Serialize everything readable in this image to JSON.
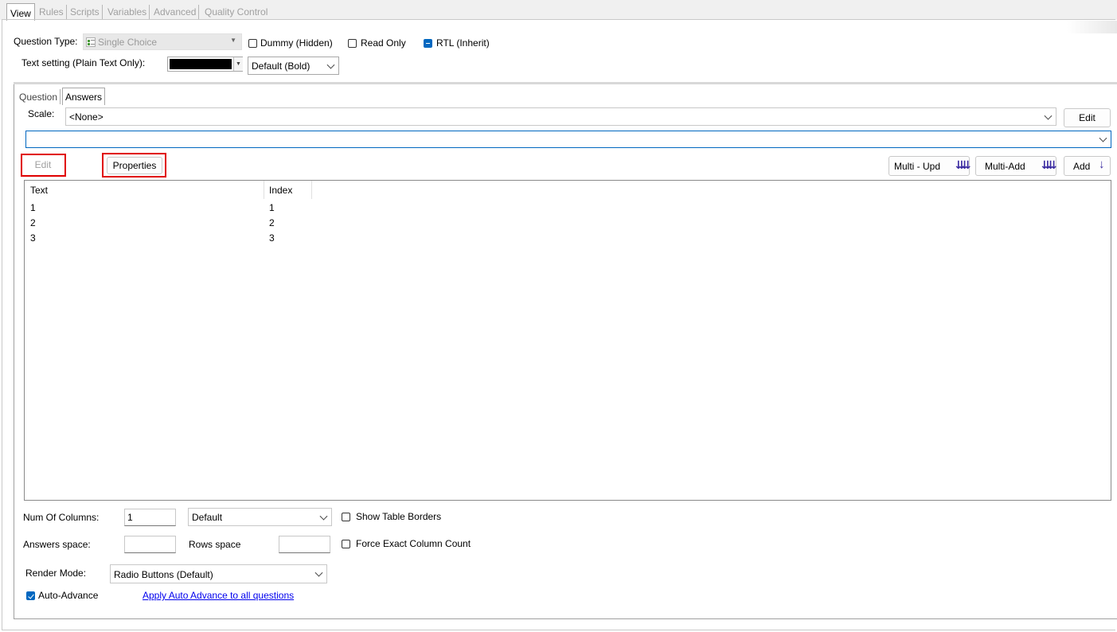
{
  "top_tabs": [
    "View",
    "Rules",
    "Scripts",
    "Variables",
    "Advanced",
    "Quality Control"
  ],
  "question_type": {
    "label": "Question Type:",
    "value": "Single Choice"
  },
  "checkboxes": {
    "dummy": "Dummy (Hidden)",
    "read_only": "Read Only",
    "rtl": "RTL (Inherit)"
  },
  "text_setting": {
    "label": "Text setting (Plain Text Only):",
    "color": "#000000",
    "style_value": "Default (Bold)"
  },
  "inner_tabs": [
    "Question",
    "Answers"
  ],
  "scale": {
    "label": "Scale:",
    "value": "<None>",
    "edit_label": "Edit"
  },
  "actions": {
    "edit": "Edit",
    "properties": "Properties",
    "multi_upd": "Multi - Upd",
    "multi_add": "Multi-Add",
    "add": "Add"
  },
  "grid": {
    "columns": [
      "Text",
      "Index"
    ],
    "rows": [
      {
        "text": "1",
        "index": "1"
      },
      {
        "text": "2",
        "index": "2"
      },
      {
        "text": "3",
        "index": "3"
      }
    ]
  },
  "footer": {
    "num_columns_label": "Num Of Columns:",
    "num_columns_value": "1",
    "columns_mode": "Default",
    "show_table_borders": "Show Table Borders",
    "answers_space_label": "Answers space:",
    "answers_space_value": "",
    "rows_space_label": "Rows space",
    "rows_space_value": "",
    "force_exact": "Force Exact Column Count",
    "render_mode_label": "Render Mode:",
    "render_mode_value": "Radio Buttons (Default)",
    "auto_advance": "Auto-Advance",
    "apply_link": "Apply Auto Advance to all questions"
  },
  "colors": {
    "accent": "#0067c0",
    "highlight": "#e00000",
    "link": "#0000ee"
  }
}
